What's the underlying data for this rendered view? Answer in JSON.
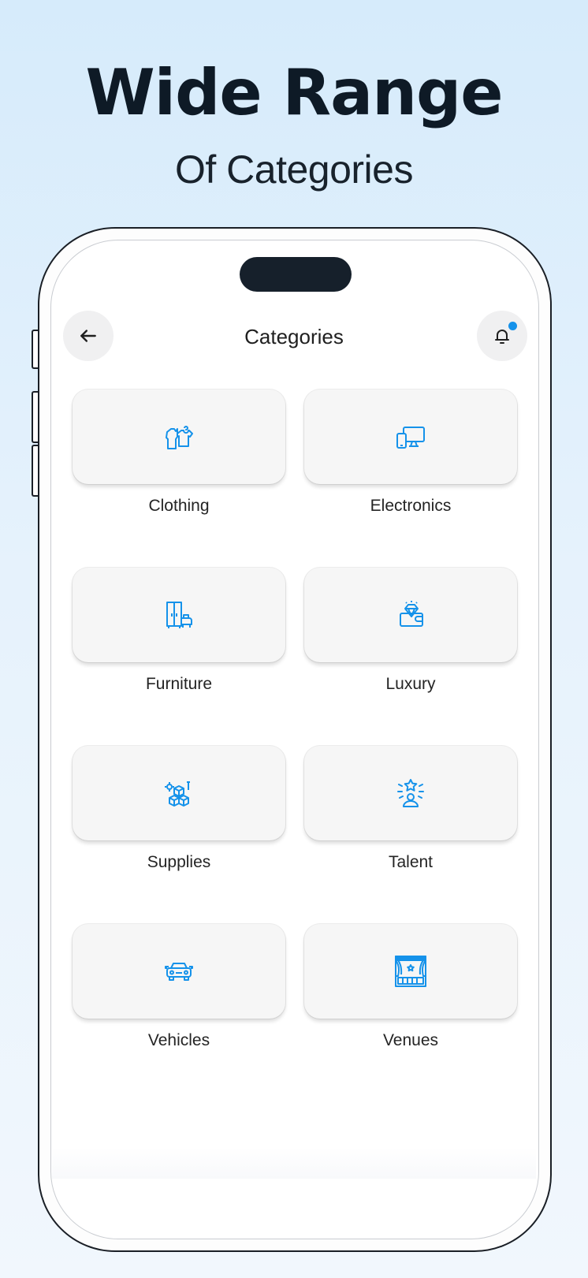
{
  "promo": {
    "headline": "Wide Range",
    "subheadline": "Of Categories"
  },
  "header": {
    "title": "Categories",
    "back_icon": "arrow-left-icon",
    "notification_icon": "bell-icon",
    "notification_dot_color": "#1592ea"
  },
  "accent_color": "#1592ea",
  "categories": [
    {
      "label": "Clothing",
      "icon": "clothing-icon"
    },
    {
      "label": "Electronics",
      "icon": "devices-icon"
    },
    {
      "label": "Furniture",
      "icon": "wardrobe-chair-icon"
    },
    {
      "label": "Luxury",
      "icon": "diamond-wallet-icon"
    },
    {
      "label": "Supplies",
      "icon": "boxes-icon"
    },
    {
      "label": "Talent",
      "icon": "star-person-icon"
    },
    {
      "label": "Vehicles",
      "icon": "car-icon"
    },
    {
      "label": "Venues",
      "icon": "stage-icon"
    }
  ]
}
